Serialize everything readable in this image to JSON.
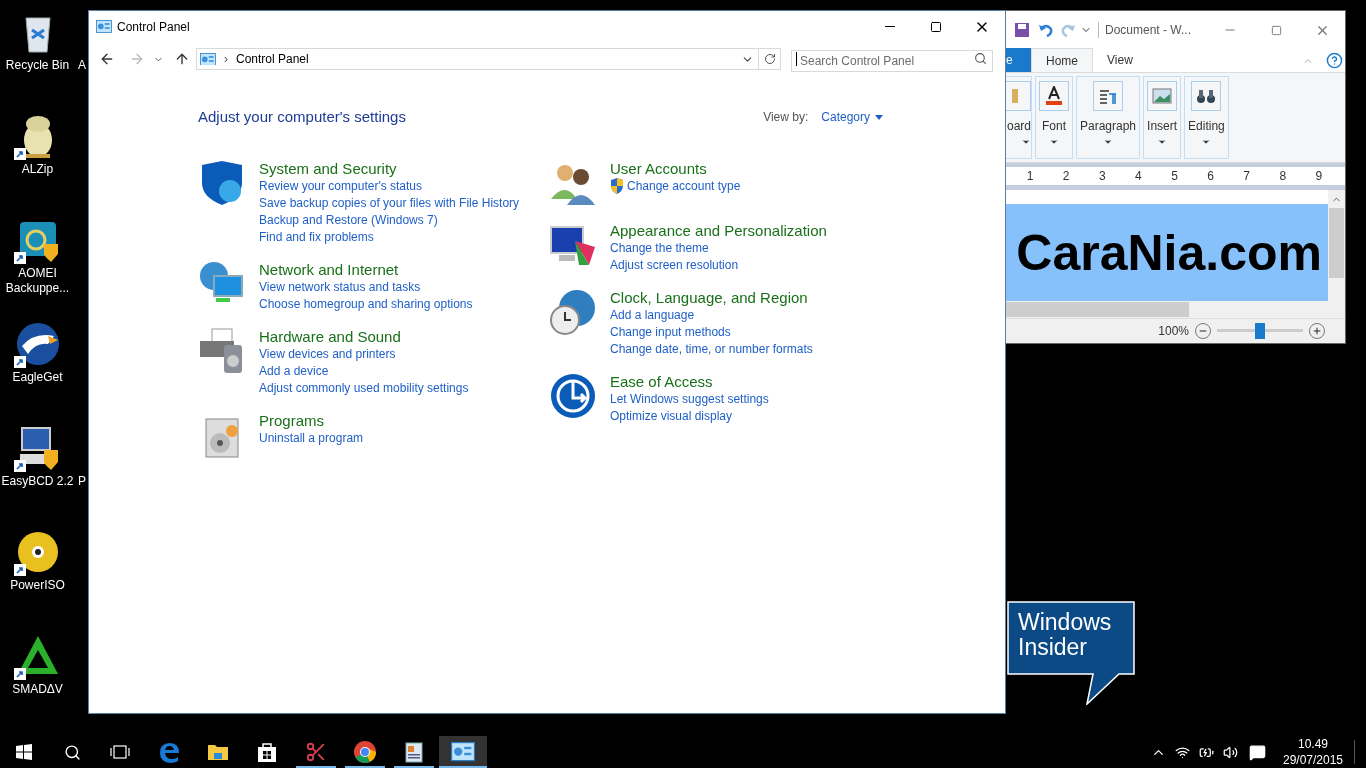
{
  "desktop": {
    "icons": [
      {
        "label": "Recycle Bin",
        "kind": "bin",
        "shortcut": false,
        "neighbor_label": "A"
      },
      {
        "label": "ALZip",
        "kind": "alzip",
        "shortcut": true
      },
      {
        "label": "AOMEI Backuppe...",
        "kind": "aomei",
        "shortcut": true
      },
      {
        "label": "EagleGet",
        "kind": "eagle",
        "shortcut": true
      },
      {
        "label": "EasyBCD 2.2",
        "kind": "easybcd",
        "shortcut": true,
        "neighbor_label": "P"
      },
      {
        "label": "PowerISO",
        "kind": "disc",
        "shortcut": true
      },
      {
        "label": "SMADΔV",
        "kind": "smadav",
        "shortcut": true
      }
    ],
    "badge": {
      "lines": [
        "Windows",
        "Insider"
      ]
    }
  },
  "control_panel": {
    "title": "Control Panel",
    "address": {
      "separator": "›",
      "crumb": "Control Panel"
    },
    "search": {
      "placeholder": "Search Control Panel"
    },
    "heading": "Adjust your computer's settings",
    "view_by": {
      "label": "View by:",
      "value": "Category"
    },
    "columns": [
      [
        {
          "title": "System and Security",
          "kind": "shield",
          "links": [
            {
              "text": "Review your computer's status",
              "admin": false
            },
            {
              "text": "Save backup copies of your files with File History",
              "admin": false
            },
            {
              "text": "Backup and Restore (Windows 7)",
              "admin": false
            },
            {
              "text": "Find and fix problems",
              "admin": false
            }
          ]
        },
        {
          "title": "Network and Internet",
          "kind": "network",
          "links": [
            {
              "text": "View network status and tasks",
              "admin": false
            },
            {
              "text": "Choose homegroup and sharing options",
              "admin": false
            }
          ]
        },
        {
          "title": "Hardware and Sound",
          "kind": "printer",
          "links": [
            {
              "text": "View devices and printers",
              "admin": false
            },
            {
              "text": "Add a device",
              "admin": false
            },
            {
              "text": "Adjust commonly used mobility settings",
              "admin": false
            }
          ]
        },
        {
          "title": "Programs",
          "kind": "programs",
          "links": [
            {
              "text": "Uninstall a program",
              "admin": false
            }
          ]
        }
      ],
      [
        {
          "title": "User Accounts",
          "kind": "users",
          "links": [
            {
              "text": "Change account type",
              "admin": true
            }
          ]
        },
        {
          "title": "Appearance and Personalization",
          "kind": "appearance",
          "links": [
            {
              "text": "Change the theme",
              "admin": false
            },
            {
              "text": "Adjust screen resolution",
              "admin": false
            }
          ]
        },
        {
          "title": "Clock, Language, and Region",
          "kind": "clock",
          "links": [
            {
              "text": "Add a language",
              "admin": false
            },
            {
              "text": "Change input methods",
              "admin": false
            },
            {
              "text": "Change date, time, or number formats",
              "admin": false
            }
          ]
        },
        {
          "title": "Ease of Access",
          "kind": "ease",
          "links": [
            {
              "text": "Let Windows suggest settings",
              "admin": false
            },
            {
              "text": "Optimize visual display",
              "admin": false
            }
          ]
        }
      ]
    ]
  },
  "wordpad": {
    "title": "Document - W...",
    "tabs": [
      {
        "label": "e",
        "kind": "file",
        "selected": false
      },
      {
        "label": "Home",
        "kind": "tab",
        "selected": true
      },
      {
        "label": "View",
        "kind": "tab",
        "selected": false
      }
    ],
    "groups": [
      {
        "label": "oard",
        "kind": "clipboard"
      },
      {
        "label": "Font",
        "kind": "font"
      },
      {
        "label": "Paragraph",
        "kind": "paragraph"
      },
      {
        "label": "Insert",
        "kind": "insert"
      },
      {
        "label": "Editing",
        "kind": "editing"
      }
    ],
    "ruler": [
      "1",
      "2",
      "3",
      "4",
      "5",
      "6",
      "7",
      "8",
      "9"
    ],
    "document_text": "CaraNia.com",
    "zoom": {
      "reading": "100%",
      "level": 0.5
    }
  },
  "taskbar": {
    "apps": [
      {
        "kind": "edge",
        "running": false,
        "selected": false
      },
      {
        "kind": "explorer",
        "running": false,
        "selected": false
      },
      {
        "kind": "store",
        "running": false,
        "selected": false
      },
      {
        "kind": "snipping",
        "running": true,
        "selected": false
      },
      {
        "kind": "chrome",
        "running": true,
        "selected": false
      },
      {
        "kind": "wordpad",
        "running": true,
        "selected": false
      },
      {
        "kind": "control",
        "running": true,
        "selected": true
      }
    ],
    "clock": {
      "time": "10.49",
      "date": "29/07/2015"
    }
  }
}
